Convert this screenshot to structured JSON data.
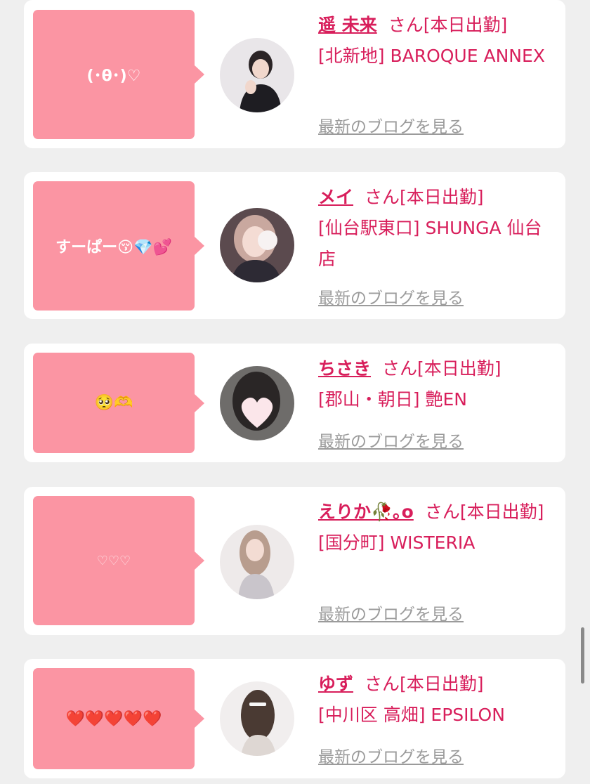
{
  "colors": {
    "bubble": "#fb95a3",
    "accent": "#d81e5b",
    "link_gray": "#9b9b9b",
    "background": "#efefef"
  },
  "cards": [
    {
      "message": "(･θ･)♡",
      "name": "遥 未来",
      "status": "さん[本日出勤]",
      "shop": "[北新地] BAROQUE ANNEX",
      "blog_link": "最新のブログを見る"
    },
    {
      "message": "すーぱー😚💎💕",
      "name": "メイ",
      "status": "さん[本日出勤]",
      "shop": "[仙台駅東口] SHUNGA 仙台店",
      "blog_link": "最新のブログを見る"
    },
    {
      "message": "🥺🫶",
      "name": "ちさき",
      "status": "さん[本日出勤]",
      "shop": "[郡山・朝日] 艶EN",
      "blog_link": "最新のブログを見る"
    },
    {
      "message": "♡♡♡",
      "name": "えりか🥀｡o",
      "status": "さん[本日出勤]",
      "shop": "[国分町] WISTERIA",
      "blog_link": "最新のブログを見る"
    },
    {
      "message": "❤️❤️❤️❤️❤️",
      "name": "ゆず",
      "status": "さん[本日出勤]",
      "shop": "[中川区 高畑] EPSILON",
      "blog_link": "最新のブログを見る"
    }
  ]
}
